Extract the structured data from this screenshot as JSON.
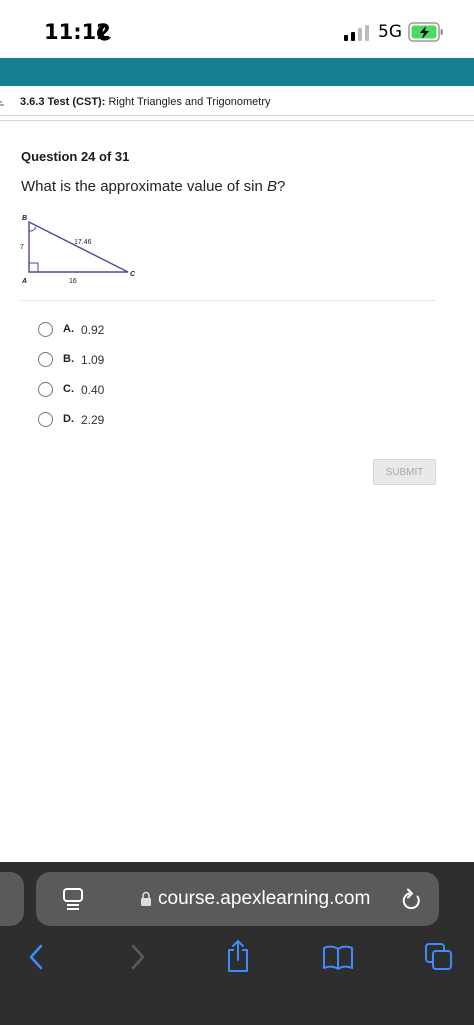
{
  "status_bar": {
    "time": "11:12",
    "network": "5G"
  },
  "breadcrumb": {
    "section": "3.6.3",
    "type": "Test (CST):",
    "title": "Right Triangles and Trigonometry"
  },
  "question": {
    "number_label": "Question 24 of 31",
    "prompt_prefix": "What is the approximate value of sin ",
    "prompt_var": "B",
    "prompt_suffix": "?"
  },
  "figure": {
    "vertex_a": "A",
    "vertex_b": "B",
    "vertex_c": "C",
    "side_ab": "7",
    "side_ac": "16",
    "side_bc": "17.46"
  },
  "options": [
    {
      "letter": "A.",
      "value": "0.92"
    },
    {
      "letter": "B.",
      "value": "1.09"
    },
    {
      "letter": "C.",
      "value": "0.40"
    },
    {
      "letter": "D.",
      "value": "2.29"
    }
  ],
  "submit_label": "SUBMIT",
  "browser": {
    "url": "course.apexlearning.com"
  },
  "colors": {
    "header": "#177f92",
    "browser_chrome": "#2e2e2f",
    "accent_blue": "#3d8bfd"
  }
}
